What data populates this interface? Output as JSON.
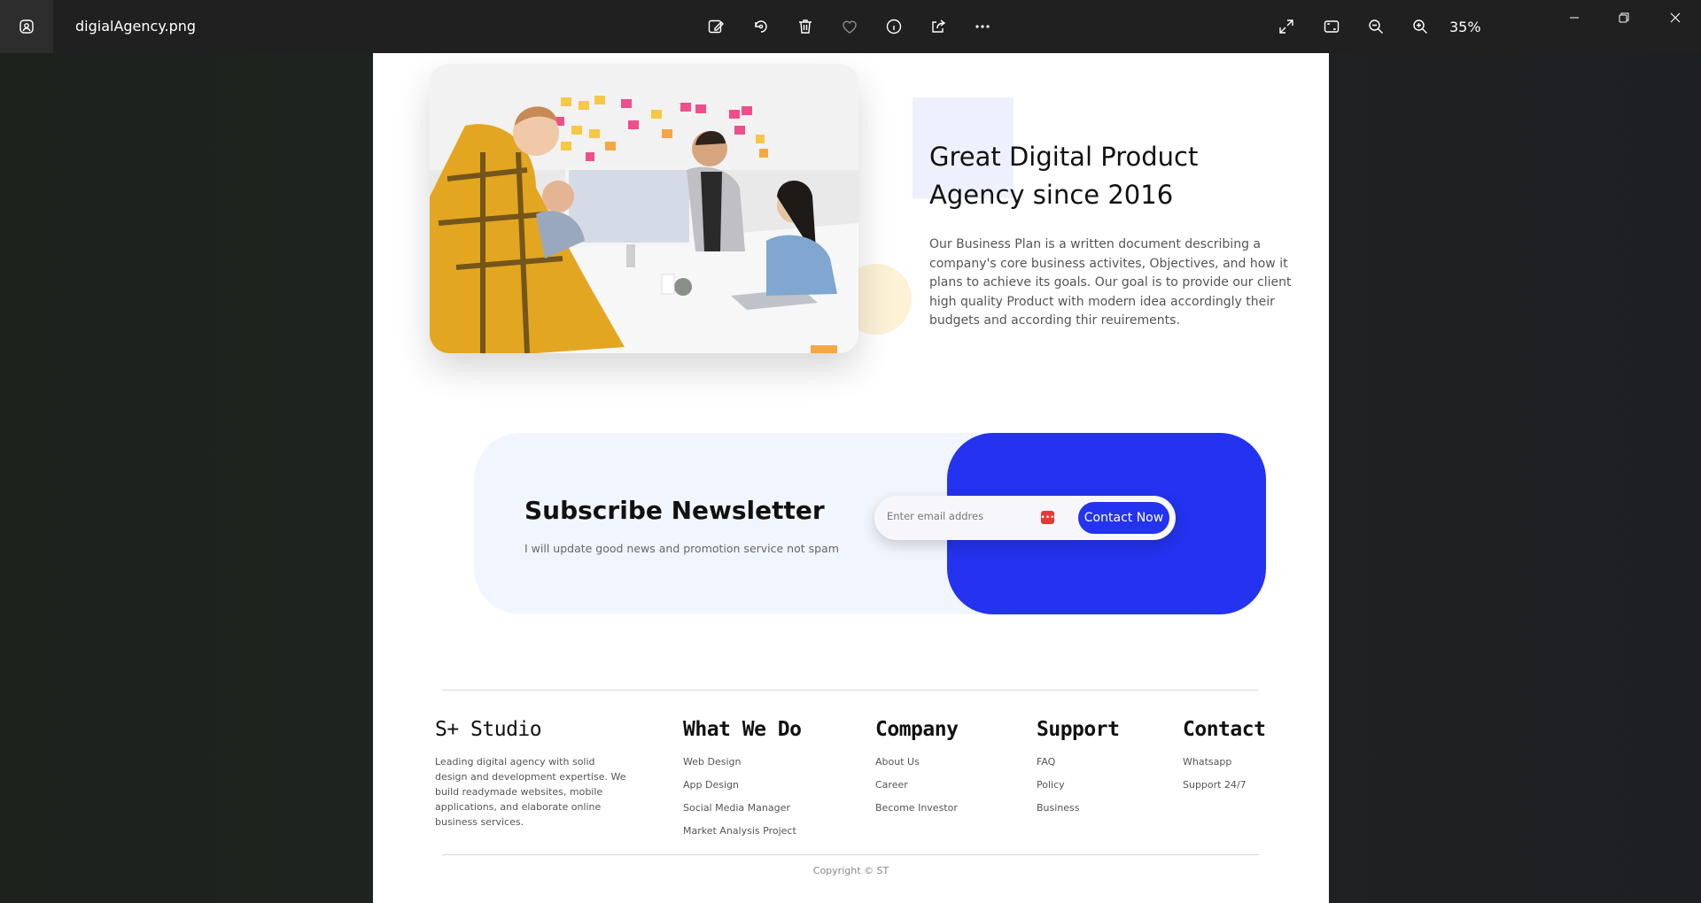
{
  "viewer": {
    "filename": "digialAgency.png",
    "zoom": "35%",
    "toolbar_icons": [
      "edit-image-icon",
      "rotate-icon",
      "delete-icon",
      "favorite-icon",
      "info-icon",
      "share-icon",
      "more-icon"
    ],
    "view_icons": [
      "fullscreen-icon",
      "fit-icon",
      "zoom-out-icon",
      "zoom-in-icon"
    ],
    "window_controls": [
      "minimize-icon",
      "restore-icon",
      "close-icon"
    ]
  },
  "hero": {
    "title": "Great Digital Product Agency since 2016",
    "body": "Our Business Plan is a written document describing a company's core business activites, Objectives, and how it plans to achieve its goals. Our goal is to provide our client high quality Product with modern idea accordingly their budgets and according thir reuirements."
  },
  "newsletter": {
    "title": "Subscribe Newsletter",
    "subtitle": "I will update good news and promotion service not spam",
    "email_placeholder": "Enter email addres",
    "button_label": "Contact Now"
  },
  "footer": {
    "brand": "S+ Studio",
    "brand_desc": "Leading digital agency with solid design and development expertise. We build readymade websites, mobile applications, and elaborate online business services.",
    "columns": [
      {
        "title": "What We Do",
        "links": [
          "Web Design",
          "App Design",
          "Social Media Manager",
          "Market Analysis Project"
        ]
      },
      {
        "title": "Company",
        "links": [
          "About Us",
          "Career",
          "Become Investor"
        ]
      },
      {
        "title": "Support",
        "links": [
          "FAQ",
          "Policy",
          "Business"
        ]
      },
      {
        "title": "Contact",
        "links": [
          "Whatsapp",
          "Support 24/7"
        ]
      }
    ],
    "copyright": "Copyright © ST"
  },
  "colors": {
    "accent_blue": "#2333ef",
    "newsletter_bg": "#f1f6fe",
    "titlebar_bg": "#202020"
  }
}
